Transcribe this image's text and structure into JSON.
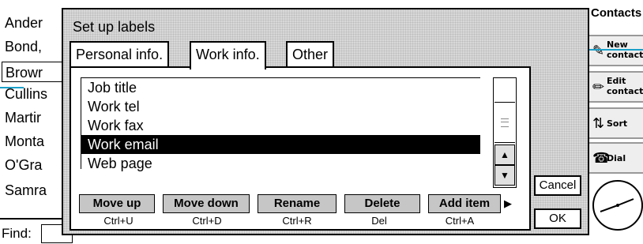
{
  "app": {
    "title": "Contacts"
  },
  "contacts": [
    {
      "name": "Ander",
      "selected": false
    },
    {
      "name": "Bond,",
      "selected": false
    },
    {
      "name": "Browr",
      "selected": true
    },
    {
      "name": "Cullins",
      "selected": false
    },
    {
      "name": "Martir",
      "selected": false
    },
    {
      "name": "Monta",
      "selected": false
    },
    {
      "name": "O'Gra",
      "selected": false
    },
    {
      "name": "Samra",
      "selected": false
    }
  ],
  "find": {
    "label": "Find:",
    "value": ""
  },
  "toolbar": {
    "new_contact": {
      "line1": "New",
      "line2": "contact",
      "icon": "new-card-icon"
    },
    "edit_contact": {
      "line1": "Edit",
      "line2": "contact",
      "icon": "edit-pen-icon"
    },
    "sort": {
      "line1": "Sort",
      "icon": "sort-icon"
    },
    "dial": {
      "line1": "Dial",
      "icon": "phone-icon"
    }
  },
  "dialog": {
    "title": "Set up labels",
    "tabs": [
      {
        "label": "Personal info.",
        "active": false
      },
      {
        "label": "Work info.",
        "active": true
      },
      {
        "label": "Other",
        "active": false
      }
    ],
    "labels": [
      "Job title",
      "Work tel",
      "Work fax",
      "Work email",
      "Web page"
    ],
    "selected_label": "Work email",
    "commands": [
      {
        "label": "Move up",
        "shortcut": "Ctrl+U"
      },
      {
        "label": "Move down",
        "shortcut": "Ctrl+D"
      },
      {
        "label": "Rename",
        "shortcut": "Ctrl+R"
      },
      {
        "label": "Delete",
        "shortcut": "Del"
      },
      {
        "label": "Add item",
        "shortcut": "Ctrl+A"
      }
    ],
    "cancel_label": "Cancel",
    "ok_label": "OK"
  },
  "colors": {
    "pointer": "#1aa0c8",
    "dialog_bg": "#d8d8d8",
    "selection": "#000000"
  }
}
